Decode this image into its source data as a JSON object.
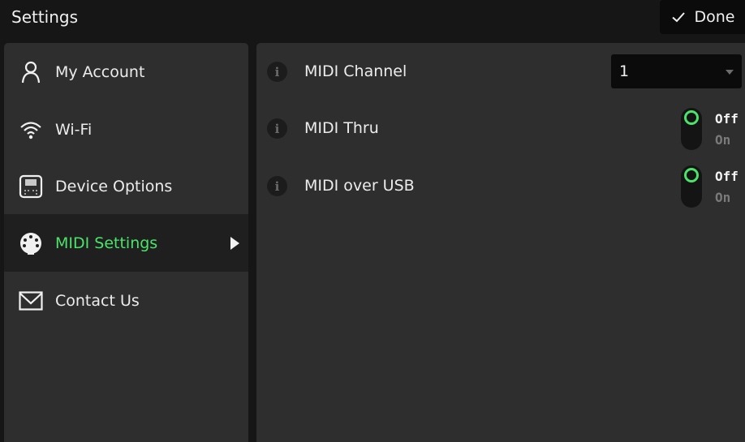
{
  "header": {
    "title": "Settings",
    "done_label": "Done"
  },
  "sidebar": {
    "items": [
      {
        "label": "My Account",
        "icon": "person-icon",
        "active": false
      },
      {
        "label": "Wi-Fi",
        "icon": "wifi-icon",
        "active": false
      },
      {
        "label": "Device Options",
        "icon": "device-icon",
        "active": false
      },
      {
        "label": "MIDI Settings",
        "icon": "midi-connector-icon",
        "active": true
      },
      {
        "label": "Contact Us",
        "icon": "envelope-icon",
        "active": false
      }
    ]
  },
  "main": {
    "midi_channel": {
      "label": "MIDI Channel",
      "value": "1"
    },
    "midi_thru": {
      "label": "MIDI Thru",
      "option_off": "Off",
      "option_on": "On",
      "state": "Off"
    },
    "midi_over_usb": {
      "label": "MIDI over USB",
      "option_off": "Off",
      "option_on": "On",
      "state": "Off"
    }
  },
  "colors": {
    "accent": "#4be36a",
    "panel": "#2e2e2e",
    "background": "#161616"
  }
}
